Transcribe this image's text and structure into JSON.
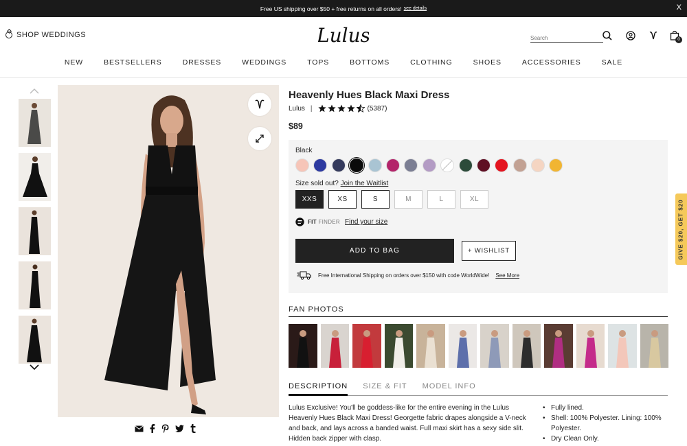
{
  "banner": {
    "text": "Free US shipping over $50 + free returns on all orders!",
    "link": "see details",
    "close": "X"
  },
  "header": {
    "shop_weddings": "SHOP WEDDINGS",
    "logo": "Lulus",
    "search_placeholder": "Search",
    "bag_count": "0"
  },
  "nav": [
    "NEW",
    "BESTSELLERS",
    "DRESSES",
    "WEDDINGS",
    "TOPS",
    "BOTTOMS",
    "CLOTHING",
    "SHOES",
    "ACCESSORIES",
    "SALE"
  ],
  "product": {
    "title": "Heavenly Hues Black Maxi Dress",
    "brand": "Lulus",
    "rating": 4.5,
    "reviews": "(5387)",
    "price": "$89"
  },
  "options": {
    "color_label": "Black",
    "swatches": [
      {
        "name": "blush",
        "color": "#f6c5b8"
      },
      {
        "name": "royal-blue",
        "color": "#2d3aa0"
      },
      {
        "name": "navy-print",
        "color": "#343a5c"
      },
      {
        "name": "black",
        "color": "#0a0a0a",
        "selected": true
      },
      {
        "name": "light-blue",
        "color": "#a9c4d3"
      },
      {
        "name": "magenta",
        "color": "#b3246a"
      },
      {
        "name": "slate",
        "color": "#7b7e93"
      },
      {
        "name": "lavender",
        "color": "#b39bc4"
      },
      {
        "name": "white",
        "color": "#ffffff"
      },
      {
        "name": "forest-green",
        "color": "#2c4b3a"
      },
      {
        "name": "wine",
        "color": "#5f0f23"
      },
      {
        "name": "red",
        "color": "#e4141f"
      },
      {
        "name": "mauve",
        "color": "#c2a193"
      },
      {
        "name": "peach",
        "color": "#f5d5c2"
      },
      {
        "name": "mustard",
        "color": "#f1b532"
      }
    ],
    "size_prompt": "Size sold out?",
    "waitlist": "Join the Waitlist",
    "sizes": [
      {
        "label": "XXS",
        "state": "selected"
      },
      {
        "label": "XS",
        "state": "available"
      },
      {
        "label": "S",
        "state": "available"
      },
      {
        "label": "M",
        "state": "out"
      },
      {
        "label": "L",
        "state": "out"
      },
      {
        "label": "XL",
        "state": "out"
      }
    ],
    "fit": "FIT",
    "finder": "FINDER",
    "find_size": "Find your size",
    "add_to_bag": "ADD TO BAG",
    "wishlist": "+ WISHLIST",
    "shipping": "Free International Shipping on orders over $150 with code WorldWide!",
    "see_more": "See More"
  },
  "fan_photos": {
    "title": "FAN PHOTOS",
    "items": [
      {
        "bg": "#2a1a18",
        "dress": "#111111"
      },
      {
        "bg": "#d9d4cf",
        "dress": "#c8203a"
      },
      {
        "bg": "#c23a3d",
        "dress": "#d81f30"
      },
      {
        "bg": "#3b4a30",
        "dress": "#f0eee8"
      },
      {
        "bg": "#c8b39a",
        "dress": "#eae0d2"
      },
      {
        "bg": "#ebe8e6",
        "dress": "#5d6fab"
      },
      {
        "bg": "#d8d2ca",
        "dress": "#8e9ab8"
      },
      {
        "bg": "#cfc7bc",
        "dress": "#2d2d2d"
      },
      {
        "bg": "#5a3c33",
        "dress": "#b02e82"
      },
      {
        "bg": "#e7dbd0",
        "dress": "#c42b8a"
      },
      {
        "bg": "#dde3e4",
        "dress": "#f3c7ba"
      },
      {
        "bg": "#b8b4aa",
        "dress": "#d8c8a0"
      }
    ]
  },
  "tabs": [
    "DESCRIPTION",
    "SIZE & FIT",
    "MODEL INFO"
  ],
  "description": "Lulus Exclusive! You'll be goddess-like for the entire evening in the Lulus Heavenly Hues Black Maxi Dress! Georgette fabric drapes alongside a V-neck and back, and lays across a banded waist. Full maxi skirt has a sexy side slit. Hidden back zipper with clasp.",
  "details": [
    "Fully lined.",
    "Shell: 100% Polyester. Lining: 100% Polyester.",
    "Dry Clean Only."
  ],
  "promo_tab": "GIVE $20, GET $20"
}
